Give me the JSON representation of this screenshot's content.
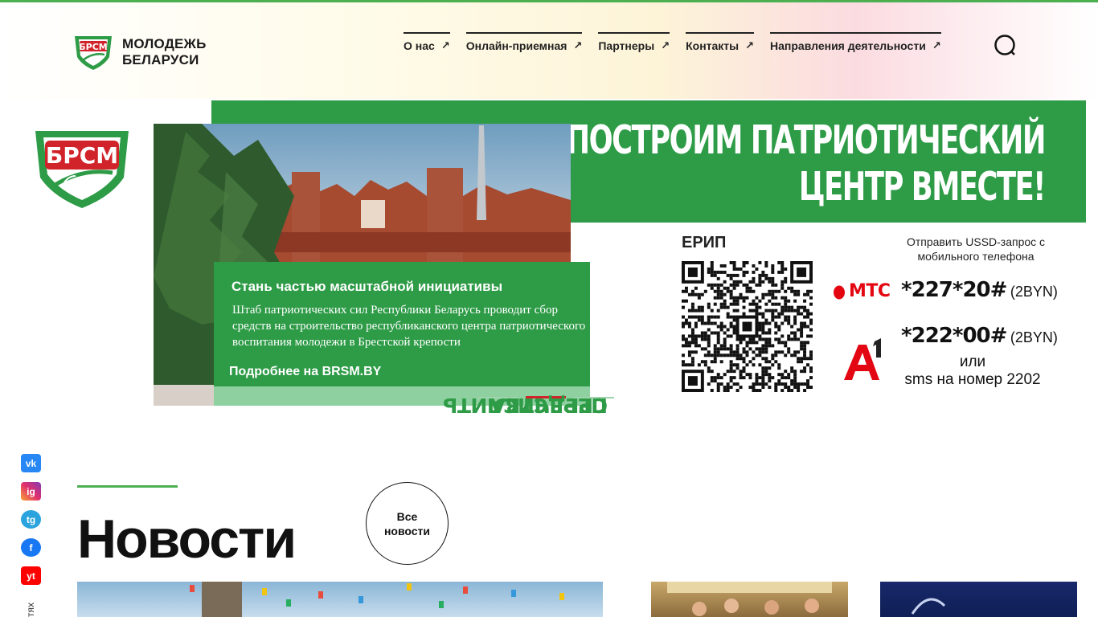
{
  "header": {
    "logo_line1": "МОЛОДЕЖЬ",
    "logo_line2": "БЕЛАРУСИ",
    "nav": [
      {
        "label": "О нас"
      },
      {
        "label": "Онлайн-приемная"
      },
      {
        "label": "Партнеры"
      },
      {
        "label": "Контакты"
      },
      {
        "label": "Направления деятельности"
      }
    ],
    "nav_arrow": "↗"
  },
  "banner": {
    "headline_line1": "ПОСТРОИМ ПАТРИОТИЧЕСКИЙ",
    "headline_line2": "ЦЕНТР ВМЕСТЕ!",
    "card_title": "Стань частью масштабной инициативы",
    "card_body": "Штаб патриотических сил Республики Беларусь проводит сбор средств на строительство республиканского центра патриотического воспитания молодежи в Брестской крепости",
    "card_link": "Подробнее на BRSM.BY",
    "vertical_text_line1": "ПЕРЕЧИСЛИТЬ",
    "vertical_text_line2": "СРЕДСТВА",
    "erip_label": "ЕРИП",
    "ussd_text": "Отправить USSD-запрос с мобильного телефона",
    "mts_name": "МТС",
    "mts_code": "*227*20#",
    "mts_price": "(2BYN)",
    "a1_code": "*222*00#",
    "a1_price": "(2BYN)",
    "or_text": "или",
    "sms_text": "sms на номер 2202",
    "slider": {
      "count": 3,
      "active_index": 1
    }
  },
  "social": {
    "vk": "vk",
    "ig": "ig",
    "tg": "tg",
    "fb": "f",
    "yt": "yt",
    "side_label": "тях"
  },
  "news": {
    "title": "Новости",
    "all_line1": "Все",
    "all_line2": "новости"
  },
  "colors": {
    "brand_green": "#2e9b47",
    "accent_red": "#d0242a",
    "mts_red": "#e30611"
  }
}
